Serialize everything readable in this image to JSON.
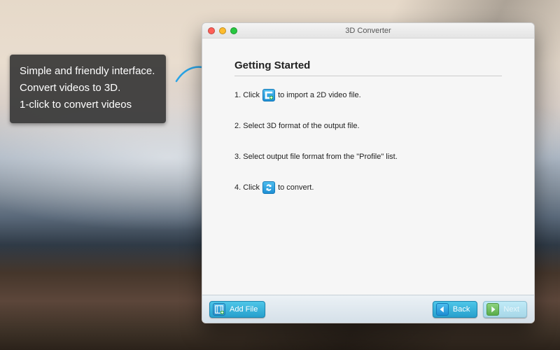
{
  "callout": {
    "line1": "Simple and friendly interface.",
    "line2": "Convert videos to 3D.",
    "line3": "1-click to convert videos"
  },
  "window": {
    "title": "3D Converter",
    "heading": "Getting Started",
    "steps": {
      "s1a": "1. Click",
      "s1b": "to import a 2D video file.",
      "s2": "2. Select 3D format of the output file.",
      "s3": "3. Select output file format from the \"Profile\" list.",
      "s4a": "4. Click",
      "s4b": "to convert."
    },
    "footer": {
      "add_file": "Add File",
      "back": "Back",
      "next": "Next"
    }
  }
}
